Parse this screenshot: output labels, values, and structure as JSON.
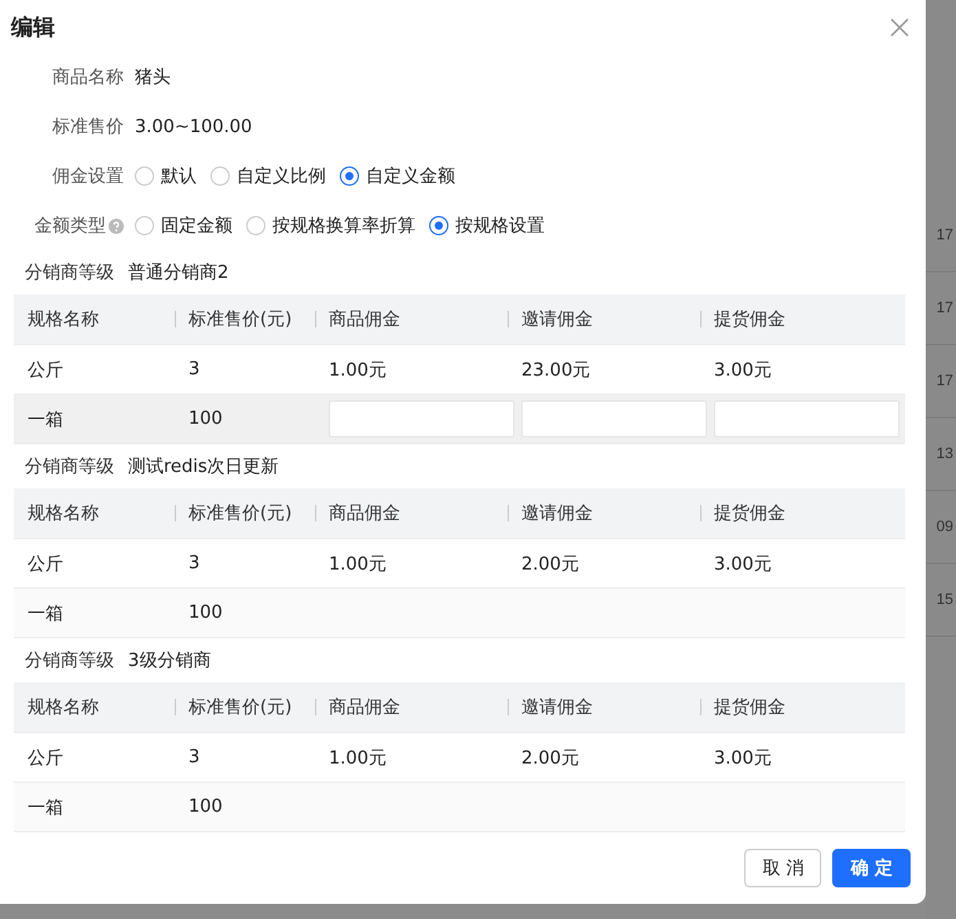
{
  "dialog": {
    "title": "编辑",
    "fields": [
      {
        "kind": "text",
        "label": "商品名称",
        "value": "猪头"
      },
      {
        "kind": "text",
        "label": "标准售价",
        "value": "3.00~100.00"
      },
      {
        "kind": "radio",
        "label": "佣金设置",
        "help": false,
        "options": [
          {
            "label": "默认",
            "selected": false
          },
          {
            "label": "自定义比例",
            "selected": false
          },
          {
            "label": "自定义金额",
            "selected": true
          }
        ]
      },
      {
        "kind": "radio",
        "label": "金额类型",
        "help": true,
        "options": [
          {
            "label": "固定金额",
            "selected": false
          },
          {
            "label": "按规格换算率折算",
            "selected": false
          },
          {
            "label": "按规格设置",
            "selected": true
          }
        ]
      }
    ],
    "levels": [
      {
        "label": "分销商等级",
        "name": "普通分销商2",
        "columns": [
          "规格名称",
          "标准售价(元)",
          "商品佣金",
          "邀请佣金",
          "提货佣金"
        ],
        "rows": [
          {
            "editing": false,
            "cells": [
              "公斤",
              "3",
              "1.00元",
              "23.00元",
              "3.00元"
            ]
          },
          {
            "editing": true,
            "cells": [
              "一箱",
              "100",
              "",
              "",
              ""
            ]
          }
        ]
      },
      {
        "label": "分销商等级",
        "name": "测试redis次日更新",
        "columns": [
          "规格名称",
          "标准售价(元)",
          "商品佣金",
          "邀请佣金",
          "提货佣金"
        ],
        "rows": [
          {
            "editing": false,
            "cells": [
              "公斤",
              "3",
              "1.00元",
              "2.00元",
              "3.00元"
            ]
          },
          {
            "editing": false,
            "cells": [
              "一箱",
              "100",
              "",
              "",
              ""
            ]
          }
        ]
      },
      {
        "label": "分销商等级",
        "name": "3级分销商",
        "columns": [
          "规格名称",
          "标准售价(元)",
          "商品佣金",
          "邀请佣金",
          "提货佣金"
        ],
        "rows": [
          {
            "editing": false,
            "cells": [
              "公斤",
              "3",
              "1.00元",
              "2.00元",
              "3.00元"
            ]
          },
          {
            "editing": false,
            "cells": [
              "一箱",
              "100",
              "",
              "",
              ""
            ]
          }
        ]
      }
    ],
    "buttons": [
      {
        "label": "取 消",
        "primary": false
      },
      {
        "label": "确 定",
        "primary": true
      }
    ]
  },
  "background": {
    "cells": [
      "17",
      "17",
      "17",
      "13",
      "09",
      "15"
    ]
  }
}
